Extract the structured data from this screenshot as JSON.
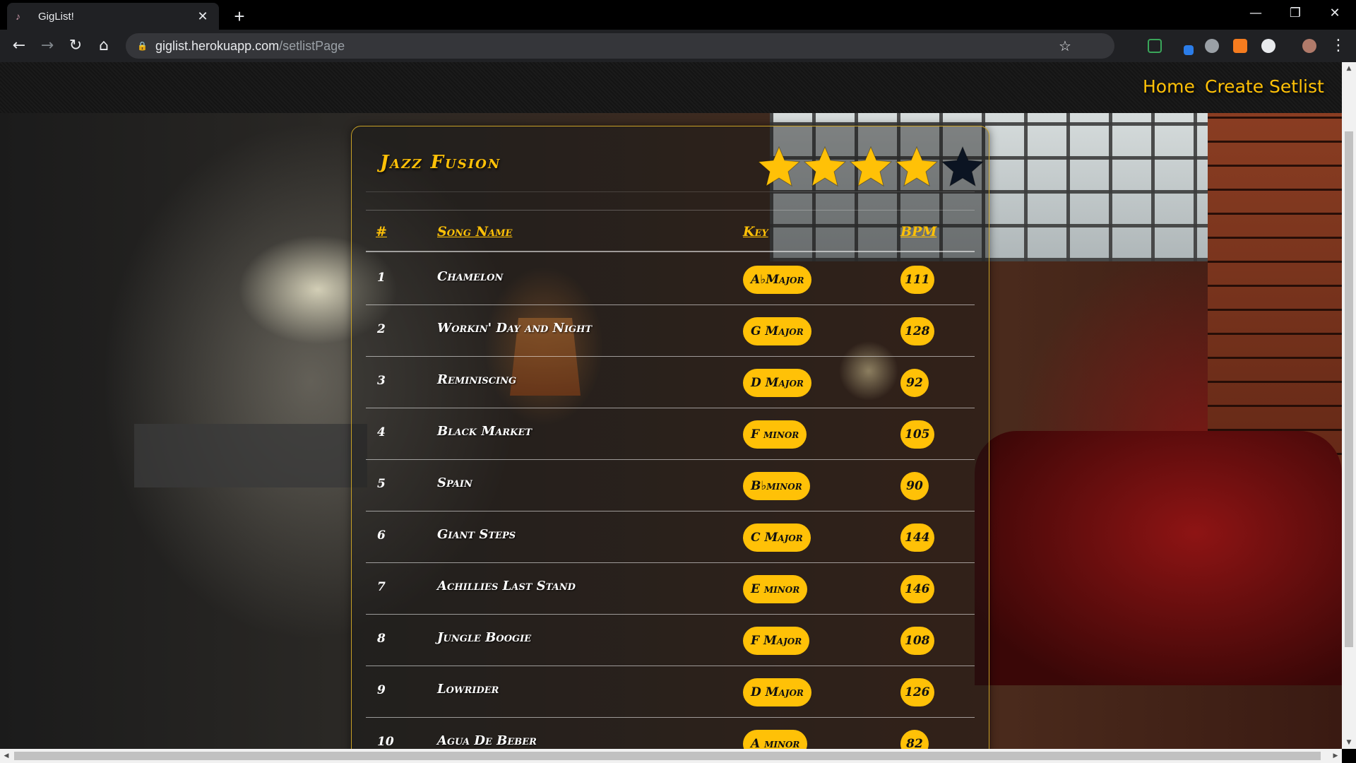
{
  "browser": {
    "tab_title": "GigList!",
    "tab_close": "✕",
    "new_tab": "+",
    "url_host": "giglist.herokuapp.com",
    "url_path": "/setlistPage"
  },
  "nav": {
    "home": "Home",
    "create_setlist": "Create Setlist"
  },
  "setlist": {
    "title": "Jazz Fusion",
    "rating": 4,
    "rating_max": 5,
    "columns": {
      "num": "#",
      "name": "Song Name",
      "key": "Key",
      "bpm": "BPM"
    },
    "songs": [
      {
        "num": "1",
        "name": "Chamelon",
        "key": "A♭Major",
        "bpm": "111"
      },
      {
        "num": "2",
        "name": "Workin' Day and Night",
        "key": "G Major",
        "bpm": "128"
      },
      {
        "num": "3",
        "name": "Reminiscing",
        "key": "D Major",
        "bpm": "92"
      },
      {
        "num": "4",
        "name": "Black Market",
        "key": "F minor",
        "bpm": "105"
      },
      {
        "num": "5",
        "name": "Spain",
        "key": "B♭minor",
        "bpm": "90"
      },
      {
        "num": "6",
        "name": "Giant Steps",
        "key": "C Major",
        "bpm": "144"
      },
      {
        "num": "7",
        "name": "Achillies Last Stand",
        "key": "E minor",
        "bpm": "146"
      },
      {
        "num": "8",
        "name": "Jungle Boogie",
        "key": "F Major",
        "bpm": "108"
      },
      {
        "num": "9",
        "name": "Lowrider",
        "key": "D Major",
        "bpm": "126"
      },
      {
        "num": "10",
        "name": "Agua De Beber",
        "key": "A minor",
        "bpm": "82"
      }
    ]
  },
  "colors": {
    "accent": "#ffc107",
    "star_empty": "#0b1422"
  }
}
